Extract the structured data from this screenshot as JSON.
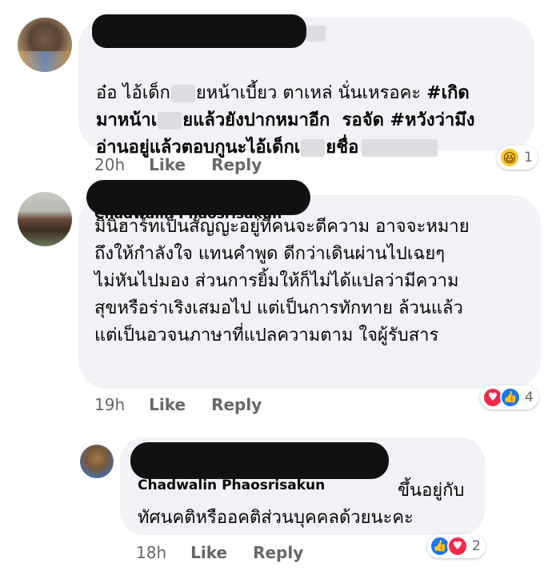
{
  "comments": [
    {
      "lines": [
        {
          "text_a": "อ๋อ ไอ้เด็ก",
          "text_b": "ยหน้าเบี้ยว ตาเหล่ นั่นเหรอคะ ",
          "text_c": "#เกิด"
        },
        {
          "text_a": "มาหน้าเ",
          "text_b": "ยแล้วยังปากหมาอีก  รอจัด ",
          "text_c": "#หวังว่ามึง"
        },
        {
          "text_a": "อ่านอยู่แล้วตอบกูนะไอ้เด็กเ",
          "text_b": "ยชื่อ",
          "text_c": ""
        }
      ],
      "time": "20h",
      "like_label": "Like",
      "reply_label": "Reply",
      "reactions": {
        "icons": [
          "haha-icon"
        ],
        "count": "1"
      }
    },
    {
      "name_partial": "Chadwalin Phaosrisakun",
      "lines": [
        "มินิฮาร์ทเป็นสัญญะอยู่ที่คนจะตีความ อาจจะหมาย",
        "ถึงให้กำลังใจ แทนคำพูด ดีกว่าเดินผ่านไปเฉยๆ",
        "ไม่หันไปมอง ส่วนการยิ้มให้ก็ไม่ได้แปลว่ามีความ",
        "สุขหรือร่าเริงเสมอไป แต่เป็นการทักทาย ล้วนแล้ว",
        "แต่เป็นอวจนภาษาที่แปลความตาม ใจผู้รับสาร"
      ],
      "time": "19h",
      "like_label": "Like",
      "reply_label": "Reply",
      "reactions": {
        "icons": [
          "heart-icon",
          "like-icon"
        ],
        "count": "4"
      }
    },
    {
      "name_partial": "Chadwalin Phaosrisakun",
      "lines": [
        " ขึ้นอยู่กับ",
        "ทัศนคติหรืออคติส่วนบุคคลด้วยนะคะ"
      ],
      "time": "18h",
      "like_label": "Like",
      "reply_label": "Reply",
      "reactions": {
        "icons": [
          "like-icon",
          "heart-icon"
        ],
        "count": "2"
      }
    }
  ],
  "colors": {
    "bubble": "#f0f2f5",
    "meta": "#65676b",
    "like": "#1877f2",
    "heart": "#f02849",
    "haha": "#f7c62c"
  }
}
